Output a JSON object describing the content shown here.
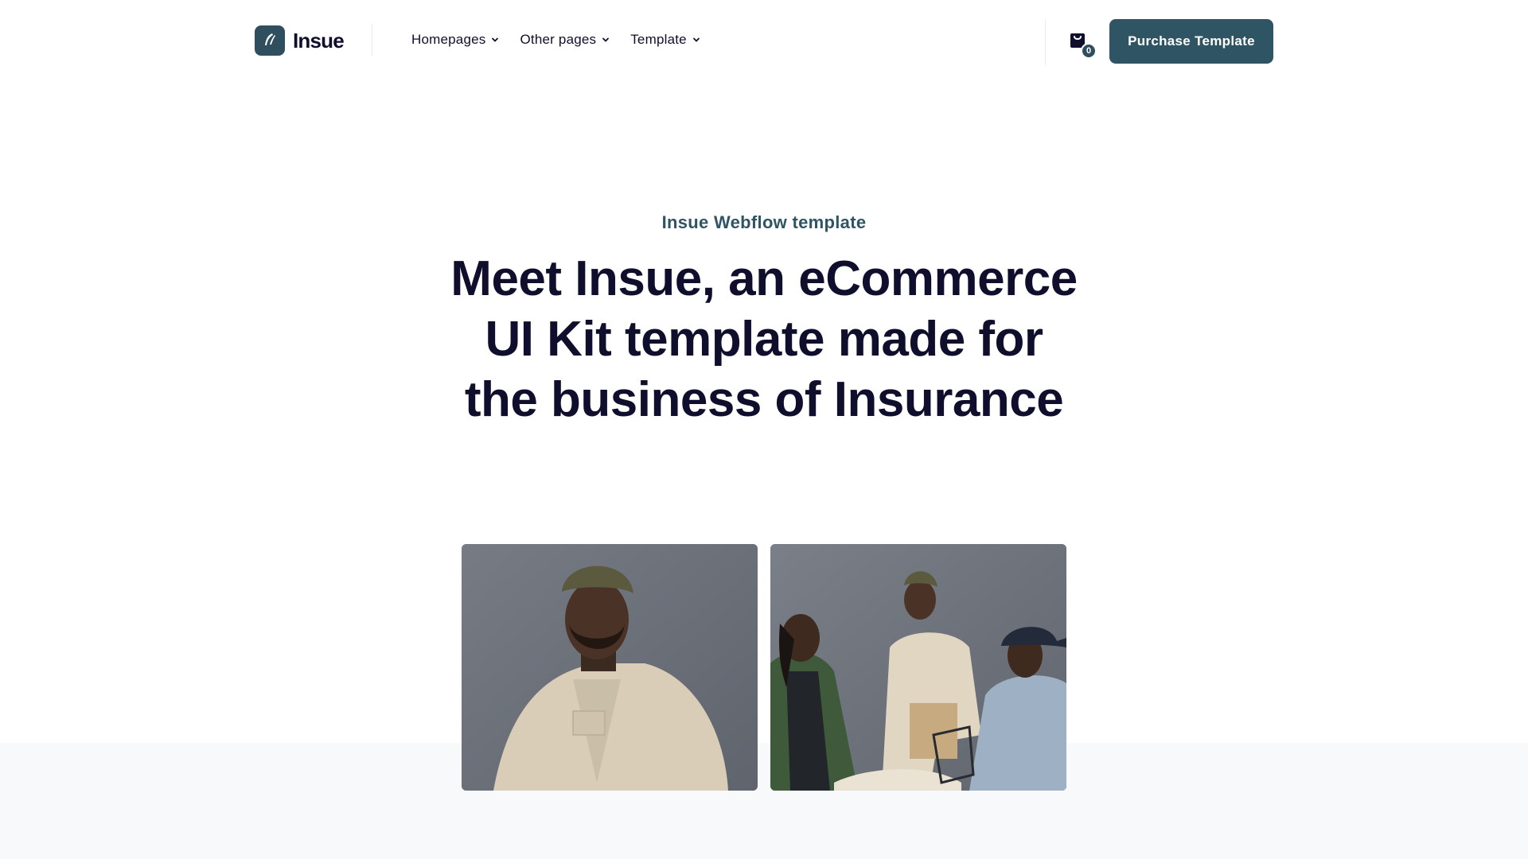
{
  "brand": {
    "name": "Insue",
    "accent": "#2f5565"
  },
  "nav": {
    "items": [
      {
        "label": "Homepages",
        "icon": "chevron-down-icon"
      },
      {
        "label": "Other pages",
        "icon": "chevron-down-icon"
      },
      {
        "label": "Template",
        "icon": "chevron-down-icon"
      }
    ]
  },
  "cart": {
    "icon": "shopping-bag-icon",
    "count": "0"
  },
  "cta": {
    "label": "Purchase Template"
  },
  "hero": {
    "eyebrow": "Insue Webflow template",
    "headline": "Meet Insue, an eCommerce UI Kit template made for the business of Insurance"
  },
  "gallery": {
    "images": [
      {
        "name": "man-in-beanie-portrait"
      },
      {
        "name": "three-men-group-photo"
      }
    ]
  }
}
